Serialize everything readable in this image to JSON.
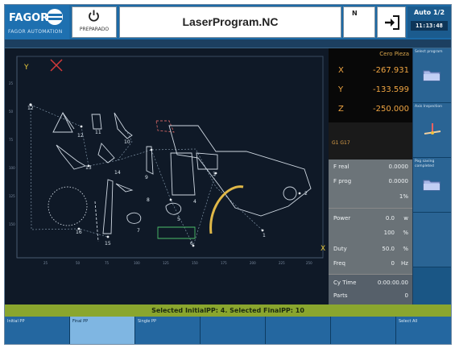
{
  "header": {
    "logo": "FAGOR",
    "logo_sub": "FAGOR AUTOMATION",
    "power_label": "PREPARADO",
    "program_title": "LaserProgram.NC",
    "n_label": "N",
    "mode": "Auto 1/2",
    "time": "11:13:48"
  },
  "canvas": {
    "axis_y": "Y",
    "axis_x": "X",
    "contour_labels": [
      "12",
      "13",
      "11",
      "10",
      "13",
      "14",
      "1",
      "2",
      "3",
      "4",
      "5",
      "6",
      "7",
      "8",
      "9",
      "15",
      "16",
      "1",
      "2"
    ]
  },
  "coords": {
    "header": "Cero Pieza",
    "rows": [
      {
        "axis": "X",
        "value": "-267.931"
      },
      {
        "axis": "Y",
        "value": "-133.599"
      },
      {
        "axis": "Z",
        "value": "-250.000"
      }
    ]
  },
  "gcode": "G1 G17",
  "feed": {
    "rows": [
      {
        "key": "F real",
        "value": "0.0000",
        "unit": ""
      },
      {
        "key": "F prog",
        "value": "0.0000",
        "unit": ""
      },
      {
        "key": "",
        "value": "1%",
        "unit": ""
      }
    ]
  },
  "spindle": {
    "rows": [
      {
        "key": "Power",
        "value": "0.0",
        "unit": "w"
      },
      {
        "key": "",
        "value": "100",
        "unit": "%"
      },
      {
        "key": "Duty",
        "value": "50.0",
        "unit": "%"
      },
      {
        "key": "Freq",
        "value": "0",
        "unit": "Hz"
      }
    ]
  },
  "bottom_panel": [
    {
      "key": "Cy Time",
      "value": "0:00:00.00"
    },
    {
      "key": "Parts",
      "value": "0"
    }
  ],
  "side_keys": [
    {
      "label": "Select program",
      "icon": "folder-icon"
    },
    {
      "label": "Axis Inspection",
      "icon": "laser-head-icon"
    },
    {
      "label": "Pog saving completed",
      "icon": "folder-icon"
    },
    {
      "label": "",
      "icon": ""
    }
  ],
  "status": "Selected InitialPP: 4. Selected FinalPP: 10",
  "fkeys": [
    "Initial PP",
    "Final PP",
    "Single PP",
    "",
    "",
    "",
    "",
    "Select All"
  ],
  "fkey_selected": 1,
  "colors": {
    "header_blue": "#1c6aa6",
    "canvas_bg": "#0f1927",
    "coord_text": "#f0a542",
    "status_green": "#8aa62e",
    "selected_key": "#7fb6e2"
  }
}
